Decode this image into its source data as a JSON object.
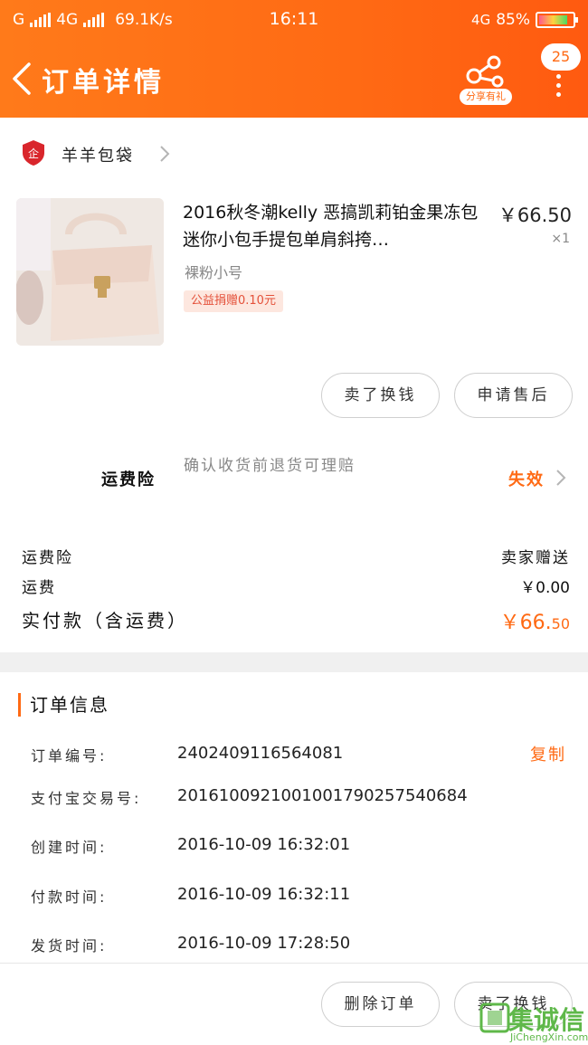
{
  "status_bar": {
    "carrier": "G",
    "network": "4G",
    "speed": "69.1K/s",
    "time": "16:11",
    "network_right": "4G",
    "battery": "85%"
  },
  "header": {
    "title": "订单详情",
    "share_label": "分享有礼",
    "badge_count": "25",
    "accent": "#ff6a14"
  },
  "shop": {
    "name": "羊羊包袋"
  },
  "product": {
    "title": "2016秋冬潮kelly 恶搞凯莉铂金果冻包迷你小包手提包单肩斜挎…",
    "price": "￥66.50",
    "quantity": "×1",
    "sku": "裸粉小号",
    "charity": "公益捐赠0.10元"
  },
  "actions": {
    "resell": "卖了换钱",
    "after_sale": "申请售后"
  },
  "insurance": {
    "label": "运费险",
    "desc": "确认收货前退货可理赔",
    "status": "失效"
  },
  "summary": {
    "insurance_label": "运费险",
    "insurance_value": "卖家赠送",
    "shipping_label": "运费",
    "shipping_value": "￥0.00",
    "total_label": "实付款（含运费）",
    "total_main": "￥66.",
    "total_cents": "50"
  },
  "order_info": {
    "title": "订单信息",
    "copy_label": "复制",
    "rows": [
      {
        "key": "订单编号:",
        "value": "2402409116564081"
      },
      {
        "key": "支付宝交易号:",
        "value": "2016100921001001790257540684"
      },
      {
        "key": "创建时间:",
        "value": "2016-10-09 16:32:01"
      },
      {
        "key": "付款时间:",
        "value": "2016-10-09 16:32:11"
      },
      {
        "key": "发货时间:",
        "value": "2016-10-09 17:28:50"
      }
    ]
  },
  "bottom_bar": {
    "delete": "删除订单",
    "resell": "卖了换钱"
  },
  "watermark": {
    "text": "集诚信",
    "sub": "JiChengXin.com"
  }
}
